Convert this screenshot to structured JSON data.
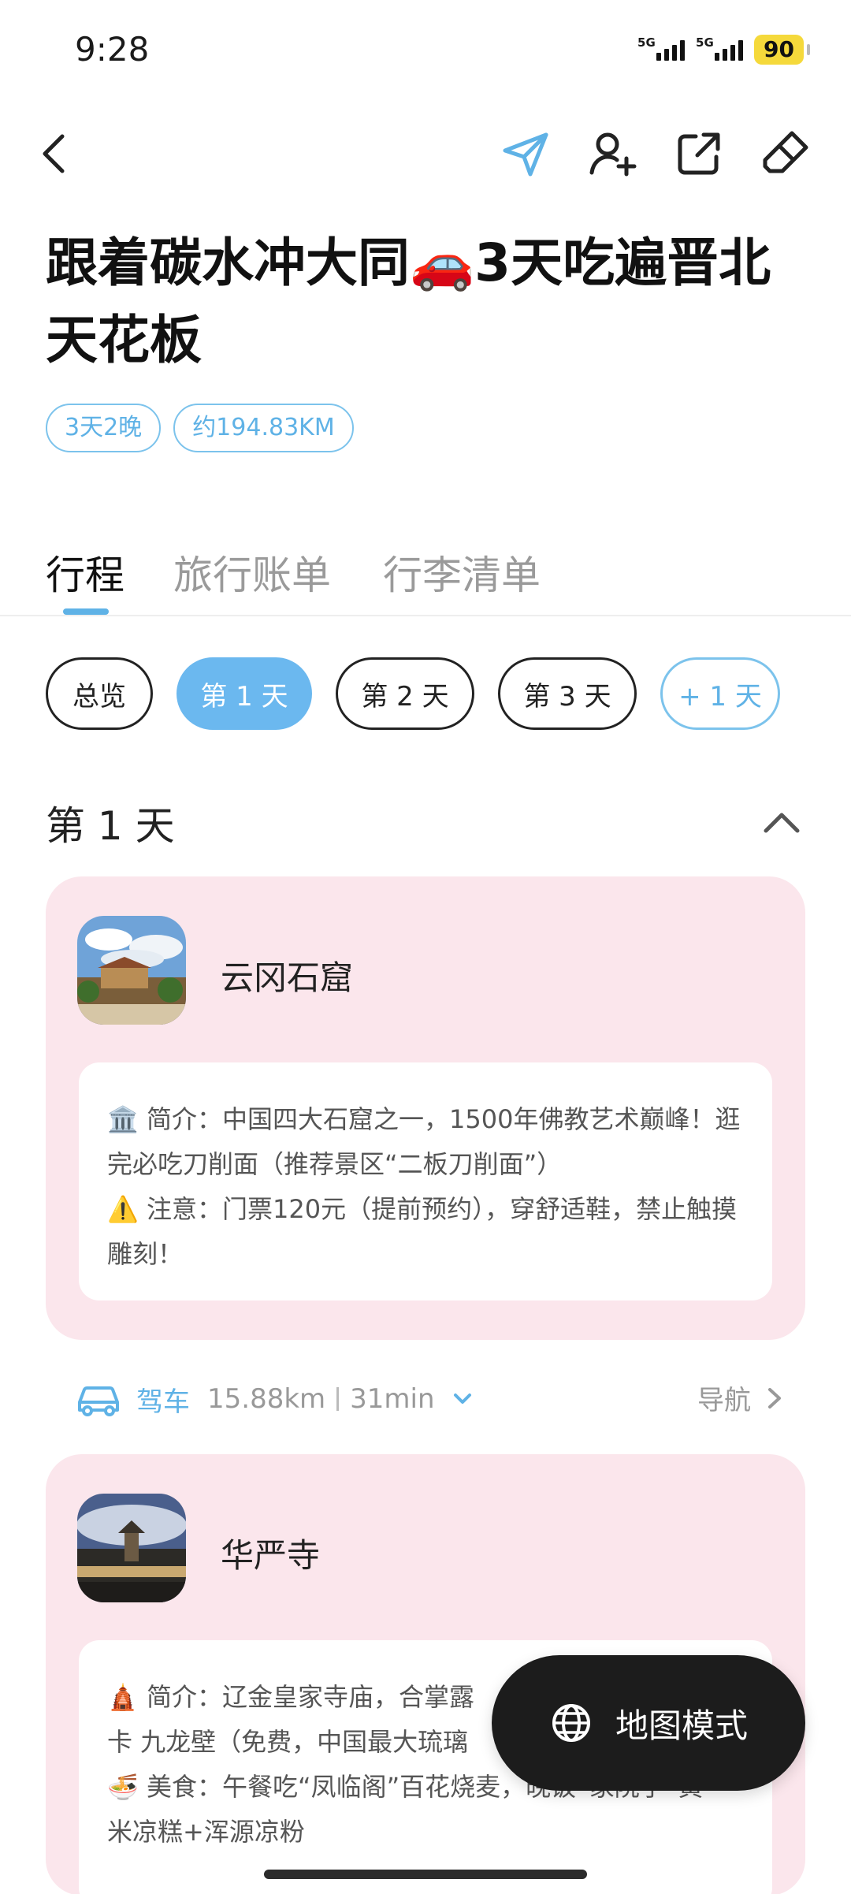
{
  "status_bar": {
    "time": "9:28",
    "network1": "5G",
    "network2": "5G",
    "battery": "90"
  },
  "nav": {
    "back": "back-icon",
    "send": "paper-plane-icon",
    "add_member": "add-user-icon",
    "share": "share-icon",
    "edit": "eraser-icon"
  },
  "trip": {
    "title": "跟着碳水冲大同🚗3天吃遍晋北天花板",
    "tags": [
      "3天2晚",
      "约194.83KM"
    ]
  },
  "tabs": [
    "行程",
    "旅行账单",
    "行李清单"
  ],
  "day_pills": [
    "总览",
    "第 1 天",
    "第 2 天",
    "第 3 天",
    "+ 1 天"
  ],
  "day": {
    "title": "第 1 天"
  },
  "places": [
    {
      "name": "云冈石窟",
      "line1": "简介：中国四大石窟之一，1500年佛教艺术巅峰！逛完必吃刀削面（推荐景区“二板刀削面”）",
      "line2": "注意：门票120元（提前预约），穿舒适鞋，禁止触摸雕刻！"
    },
    {
      "name": "华严寺",
      "line1": "简介：辽金皇家寺庙，合掌露",
      "line1b": "卡 九龙壁（免费，中国最大琉璃",
      "line2": "美食：午餐吃“凤临阁”百花烧麦，晚饭“家院子”黄",
      "line2b": "米凉糕+浑源凉粉"
    }
  ],
  "route": {
    "mode": "驾车",
    "distance": "15.88km",
    "duration": "31min",
    "nav_label": "导航"
  },
  "map_button": {
    "label": "地图模式"
  },
  "colors": {
    "accent": "#5fb2e6",
    "card_bg": "#fbe6ec",
    "dark": "#1c1c1c"
  }
}
